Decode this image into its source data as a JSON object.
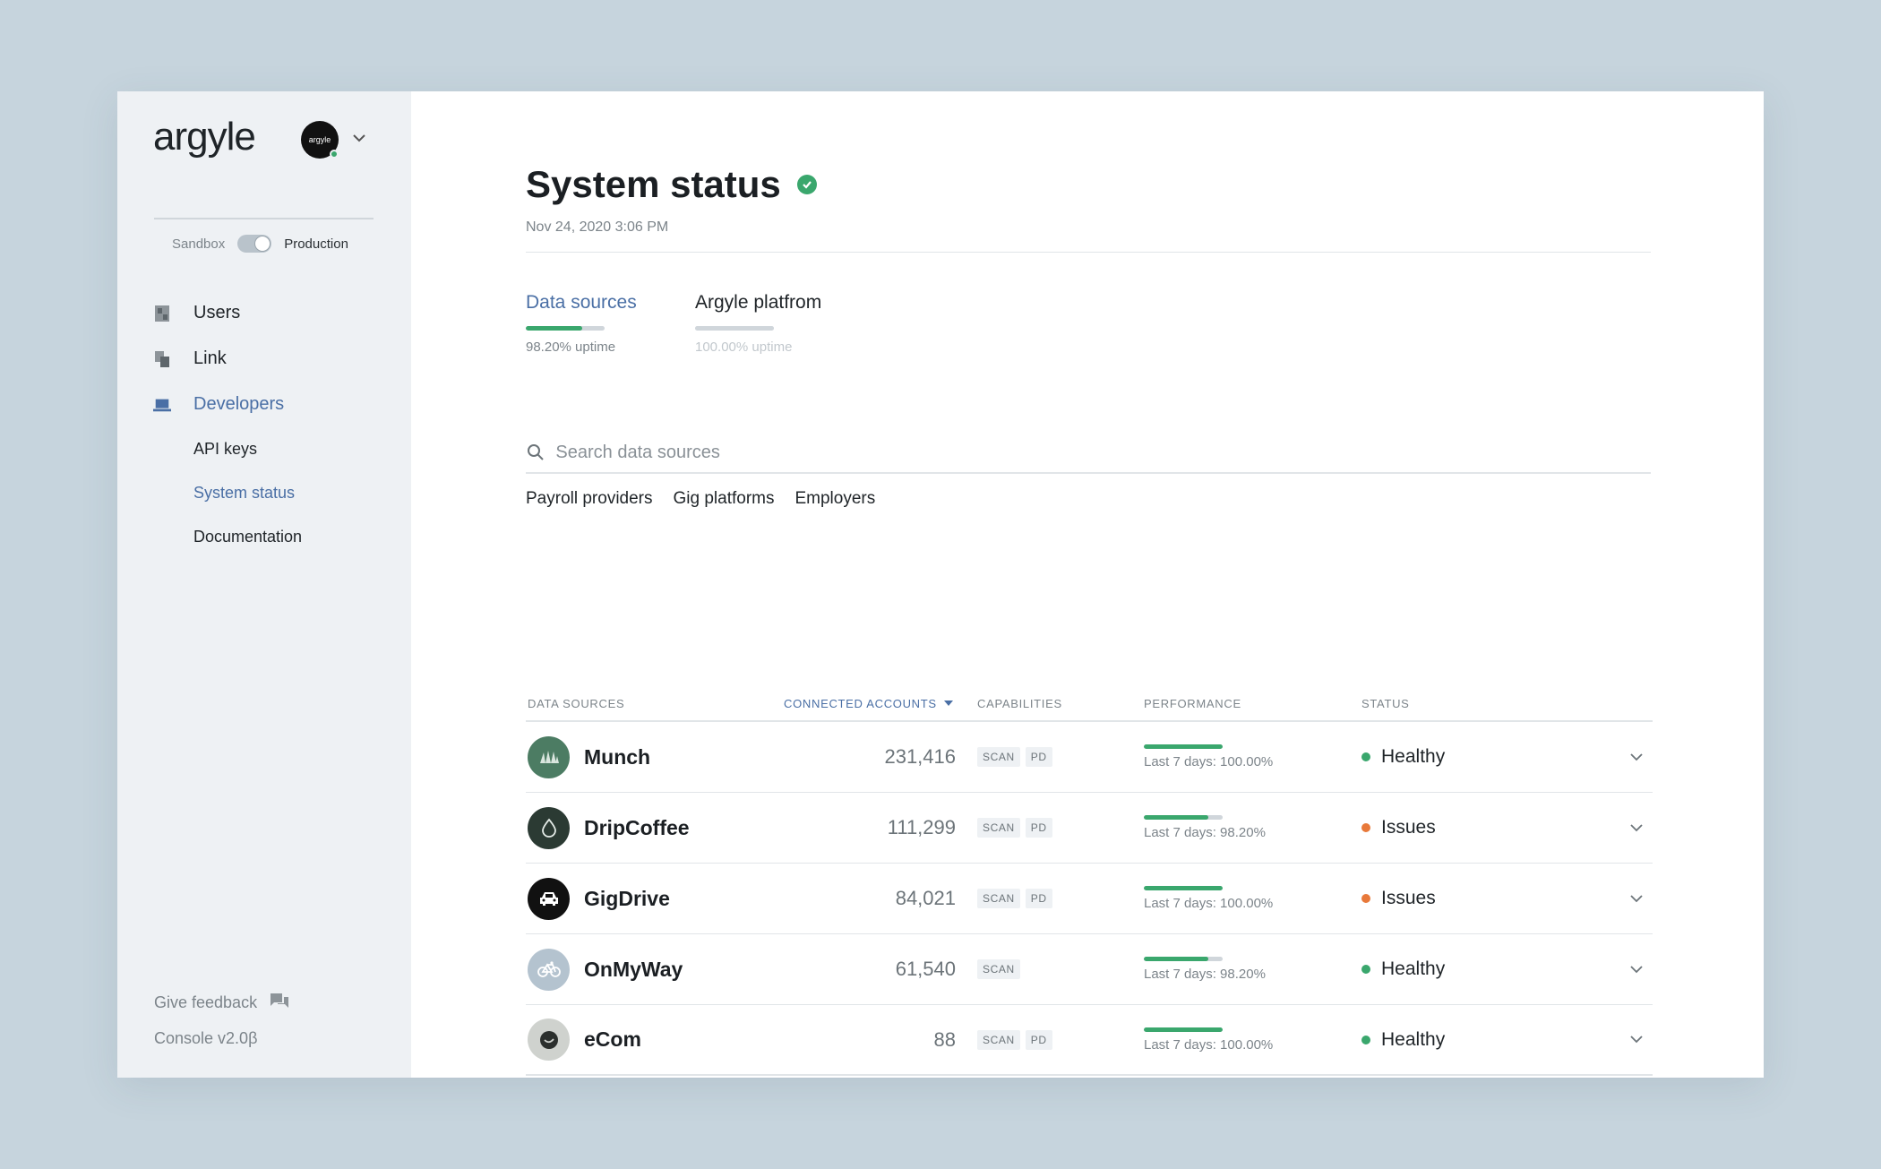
{
  "sidebar": {
    "brand": "argyle",
    "org_avatar_text": "argyle",
    "env": {
      "left": "Sandbox",
      "right": "Production",
      "selected": "Production"
    },
    "nav": [
      {
        "label": "Users",
        "icon": "users-icon"
      },
      {
        "label": "Link",
        "icon": "link-icon"
      },
      {
        "label": "Developers",
        "icon": "laptop-icon"
      }
    ],
    "subnav": [
      {
        "label": "API keys"
      },
      {
        "label": "System status"
      },
      {
        "label": "Documentation"
      }
    ],
    "footer": {
      "feedback": "Give feedback",
      "feedback_icon": "flag-icon",
      "version": "Console v2.0β"
    }
  },
  "main": {
    "title": "System status",
    "timestamp": "Nov 24, 2020  3:06 PM",
    "tabs": [
      {
        "label": "Data sources",
        "uptime": "98.20% uptime",
        "uptime_value": 98.2
      },
      {
        "label": "Argyle platfrom",
        "uptime": "100.00% uptime",
        "uptime_value": 100
      }
    ],
    "search_placeholder": "Search data sources",
    "filters": [
      "Payroll providers",
      "Gig platforms",
      "Employers"
    ],
    "table": {
      "headers": {
        "sources": "Data sources",
        "accounts": "Connected accounts",
        "capabilities": "Capabilities",
        "performance": "Performance",
        "status": "Status"
      },
      "rows": [
        {
          "name": "Munch",
          "accounts": "231,416",
          "caps": [
            "SCAN",
            "PD"
          ],
          "performance": "Last 7 days: 100.00%",
          "perf_value": 100,
          "status": "Healthy",
          "status_color": "#3aa76d",
          "logo_bg": "#4c7c63",
          "logo_fg": "#ffffff"
        },
        {
          "name": "DripCoffee",
          "accounts": "111,299",
          "caps": [
            "SCAN",
            "PD"
          ],
          "performance": "Last 7 days: 98.20%",
          "perf_value": 98.2,
          "status": "Issues",
          "status_color": "#e8793a",
          "logo_bg": "#2b3a33",
          "logo_fg": "#ffffff"
        },
        {
          "name": "GigDrive",
          "accounts": "84,021",
          "caps": [
            "SCAN",
            "PD"
          ],
          "performance": "Last 7 days: 100.00%",
          "perf_value": 100,
          "status": "Issues",
          "status_color": "#e8793a",
          "logo_bg": "#111111",
          "logo_fg": "#ffffff"
        },
        {
          "name": "OnMyWay",
          "accounts": "61,540",
          "caps": [
            "SCAN"
          ],
          "performance": "Last 7 days: 98.20%",
          "perf_value": 98.2,
          "status": "Healthy",
          "status_color": "#3aa76d",
          "logo_bg": "#b4c3cf",
          "logo_fg": "#ffffff"
        },
        {
          "name": "eCom",
          "accounts": "88",
          "caps": [
            "SCAN",
            "PD"
          ],
          "performance": "Last 7 days: 100.00%",
          "perf_value": 100,
          "status": "Healthy",
          "status_color": "#3aa76d",
          "logo_bg": "#cfd2ce",
          "logo_fg": "#2b2f2d"
        }
      ]
    }
  }
}
